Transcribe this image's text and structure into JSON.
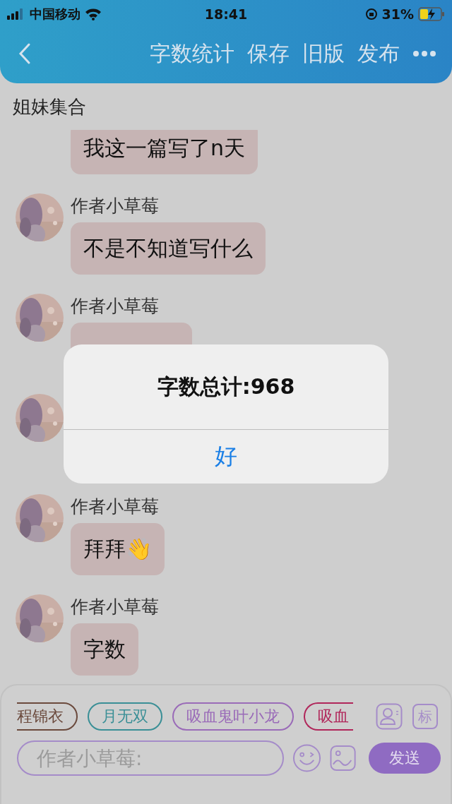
{
  "status_bar": {
    "carrier": "中国移动",
    "time": "18:41",
    "battery": "31%",
    "charging": true
  },
  "nav": {
    "actions": [
      "字数统计",
      "保存",
      "旧版",
      "发布"
    ]
  },
  "group_title": "姐妹集合",
  "messages": [
    {
      "text": "我这一篇写了n天"
    },
    {
      "avatar": {
        "kind": "picture"
      },
      "author": "作者小草莓",
      "text": "不是不知道写什么"
    },
    {
      "avatar": {
        "kind": "picture"
      },
      "author": "作者小草莓",
      "kind": "covered"
    },
    {
      "avatar": {
        "kind": "picture"
      }
    },
    {
      "avatar": {
        "kind": "picture"
      },
      "author": "作者小草莓",
      "text": "拜拜👋"
    },
    {
      "avatar": {
        "kind": "picture"
      },
      "author": "作者小草莓",
      "text": "字数"
    }
  ],
  "composer": {
    "chips": [
      {
        "label": "程锦衣",
        "color": "#6b4a3d"
      },
      {
        "label": "月无双",
        "color": "#3a8f96"
      },
      {
        "label": "吸血鬼叶小龙",
        "color": "#9a6bb8"
      },
      {
        "label": "吸血",
        "color": "#b0265a"
      }
    ],
    "tag_button": "标",
    "placeholder": "作者小草莓:",
    "send": "发送"
  },
  "dialog": {
    "title": "字数总计:968",
    "button": "好"
  }
}
